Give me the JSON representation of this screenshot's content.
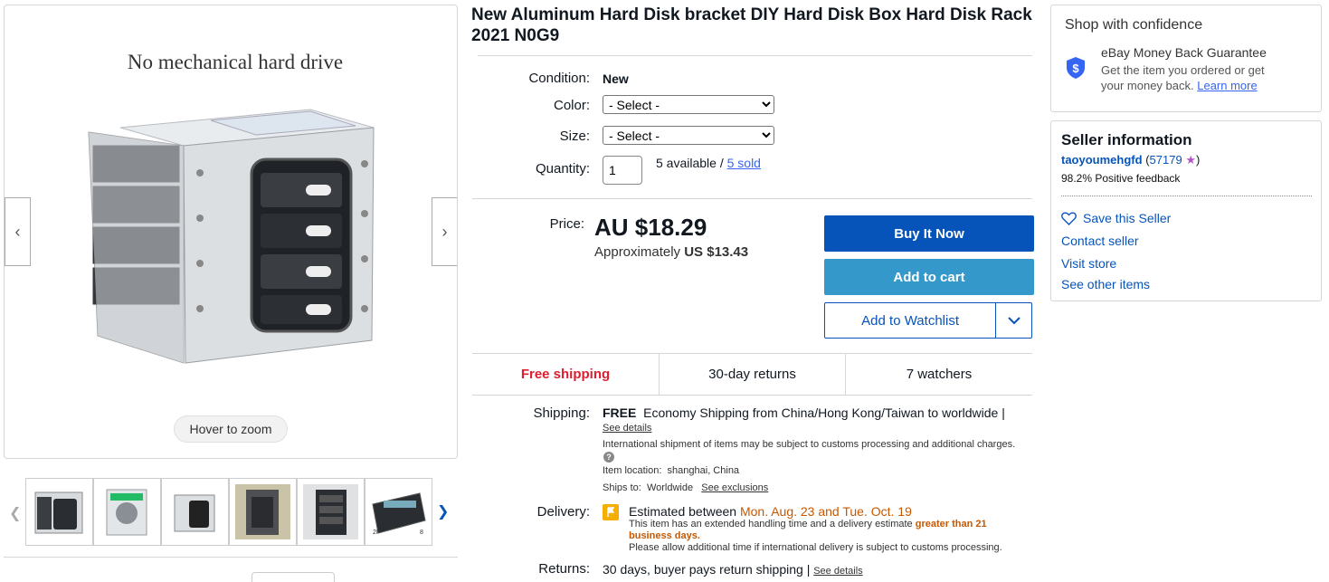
{
  "gallery": {
    "caption": "No mechanical hard drive",
    "hover_zoom": "Hover to zoom",
    "prev_icon": "chevron-left-icon",
    "next_icon": "chevron-right-icon"
  },
  "thumbnails": {
    "count": 6,
    "thumb_5_tag": "2P",
    "thumb_5_tag2": "8"
  },
  "item": {
    "title": "New Aluminum Hard Disk bracket DIY Hard Disk Box Hard Disk Rack 2021 N0G9",
    "condition_label": "Condition:",
    "condition_value": "New",
    "color_label": "Color:",
    "color_select": "- Select -",
    "size_label": "Size:",
    "size_select": "- Select -",
    "quantity_label": "Quantity:",
    "quantity_value": "1",
    "available_text": "5 available /",
    "sold_link": "5 sold"
  },
  "pricing": {
    "price_label": "Price:",
    "price": "AU $18.29",
    "approx_prefix": "Approximately",
    "approx_value": "US $13.43",
    "buy_now": "Buy It Now",
    "add_to_cart": "Add to cart",
    "add_to_watchlist": "Add to Watchlist"
  },
  "highlights": {
    "free_shipping": "Free shipping",
    "returns": "30-day returns",
    "watchers": "7 watchers"
  },
  "shipping": {
    "label": "Shipping:",
    "free": "FREE",
    "method": "Economy Shipping from China/Hong Kong/Taiwan to worldwide |",
    "see_details": "See details",
    "customs_note": "International shipment of items may be subject to customs processing and additional charges.",
    "location_label": "Item location:",
    "location_value": "shanghai, China",
    "ships_to_label": "Ships to:",
    "ships_to_value": "Worldwide",
    "see_exclusions": "See exclusions"
  },
  "delivery": {
    "label": "Delivery:",
    "estimated_prefix": "Estimated between",
    "estimated_dates": "Mon. Aug. 23 and Tue. Oct. 19",
    "handling_note": "This item has an extended handling time and a delivery estimate",
    "handling_highlight_1": "greater than 21",
    "handling_highlight_2": "business days.",
    "intl_note": "Please allow additional time if international delivery is subject to customs processing."
  },
  "returns": {
    "label": "Returns:",
    "text": "30 days, buyer pays return shipping |",
    "see_details": "See details"
  },
  "confidence": {
    "title": "Shop with confidence",
    "guarantee_title": "eBay Money Back Guarantee",
    "guarantee_line1": "Get the item you ordered or get",
    "guarantee_line2": "your money back.",
    "learn_more": "Learn more"
  },
  "seller": {
    "title": "Seller information",
    "name": "taoyoumehgfd",
    "feedback_score": "57179",
    "positive_feedback": "98.2% Positive feedback",
    "save_seller": "Save this Seller",
    "contact": "Contact seller",
    "visit_store": "Visit store",
    "other_items": "See other items"
  },
  "colors": {
    "buy_now": "#0654ba",
    "add_to_cart": "#3498ca",
    "free_shipping": "#dd1e31",
    "delivery_dates": "#c75800",
    "link": "#3665f3",
    "seller_link": "#0654ba"
  }
}
